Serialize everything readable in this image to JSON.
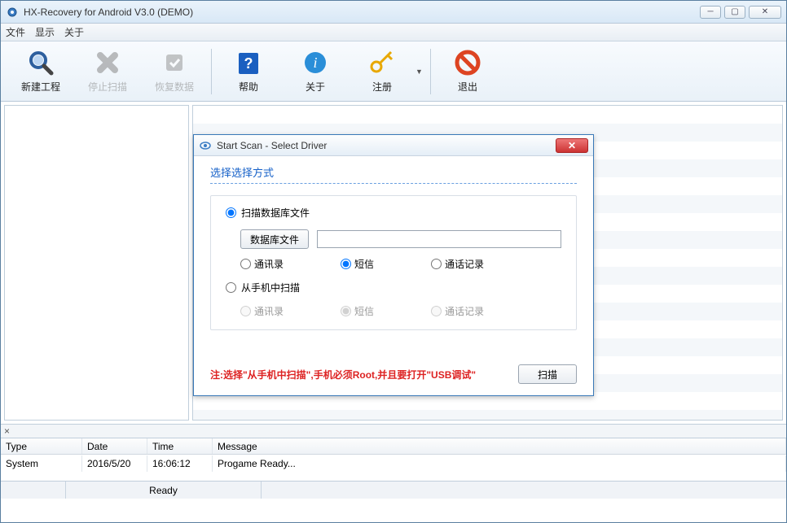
{
  "window": {
    "title": "HX-Recovery for Android V3.0 (DEMO)"
  },
  "menu": {
    "file": "文件",
    "view": "显示",
    "about": "关于"
  },
  "toolbar": {
    "new_project": "新建工程",
    "stop_scan": "停止扫描",
    "recover": "恢复数据",
    "help": "帮助",
    "about": "关于",
    "register": "注册",
    "exit": "退出"
  },
  "log": {
    "close_glyph": "×",
    "headers": {
      "type": "Type",
      "date": "Date",
      "time": "Time",
      "message": "Message"
    },
    "rows": [
      {
        "type": "System",
        "date": "2016/5/20",
        "time": "16:06:12",
        "message": "Progame Ready..."
      }
    ]
  },
  "status": {
    "ready": "Ready"
  },
  "dialog": {
    "title": "Start Scan - Select Driver",
    "heading": "选择选择方式",
    "opt_scan_db": "扫描数据库文件",
    "btn_db_file": "数据库文件",
    "db_path": "",
    "sub_contacts": "通讯录",
    "sub_sms": "短信",
    "sub_calllog": "通话记录",
    "opt_scan_phone": "从手机中扫描",
    "note": "注:选择\"从手机中扫描\",手机必须Root,并且要打开\"USB调试\"",
    "btn_scan": "扫描"
  }
}
